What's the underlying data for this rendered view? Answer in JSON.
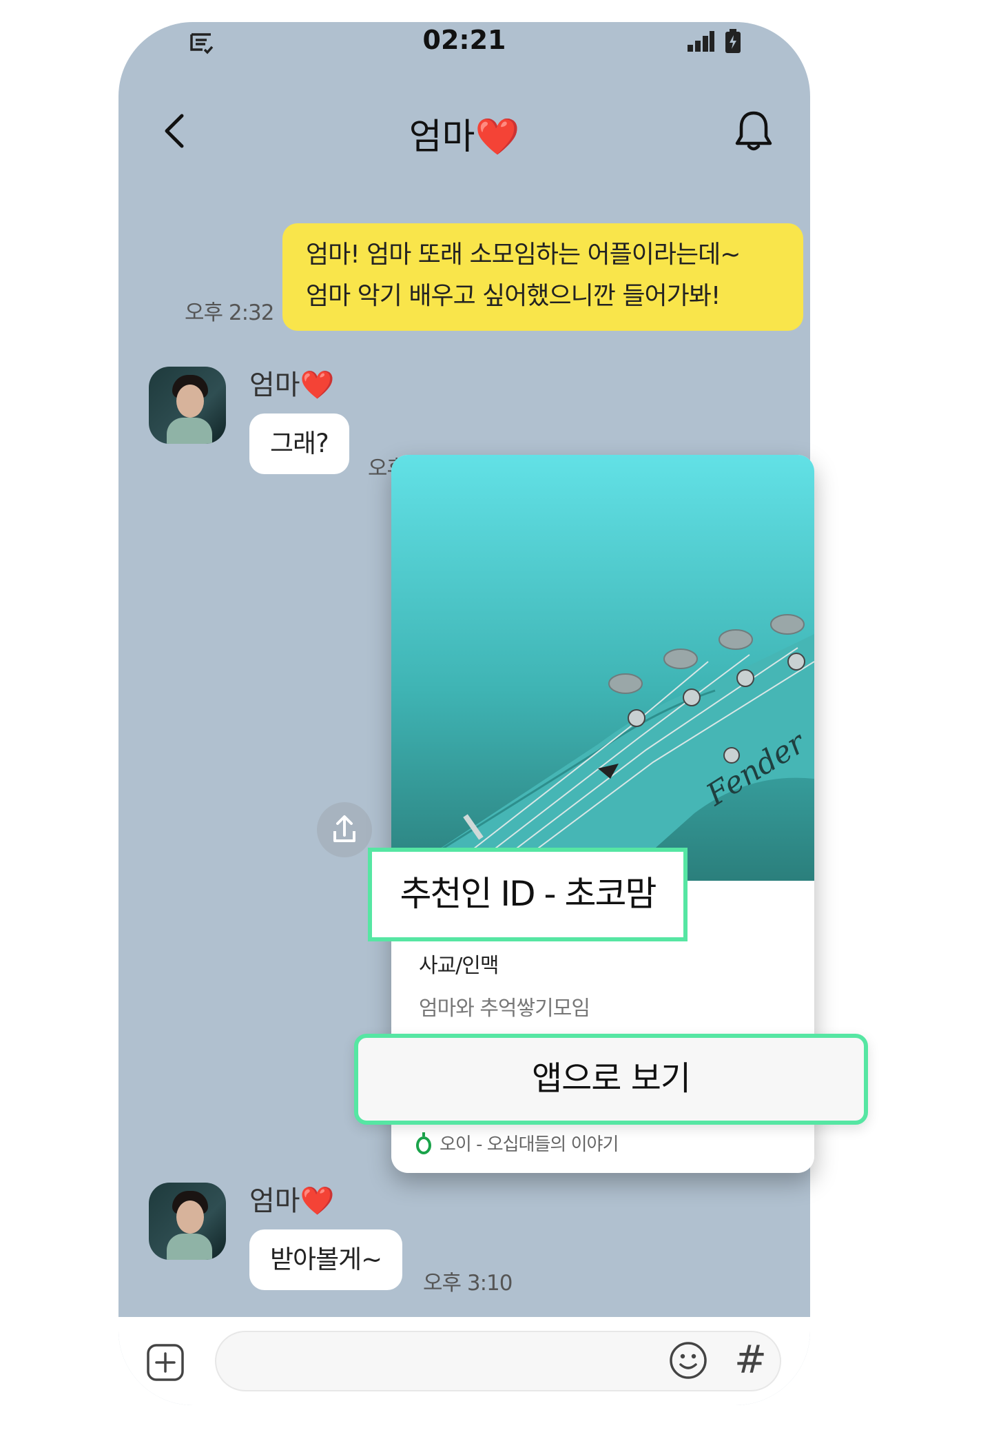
{
  "status_bar": {
    "time": "02:21"
  },
  "header": {
    "title": "엄마❤️"
  },
  "messages": {
    "me": {
      "line1": "엄마! 엄마 또래 소모임하는 어플이라는데~",
      "line2": "엄마 악기 배우고 싶어했으니깐 들어가봐!",
      "time": "오후 2:32"
    },
    "mom1": {
      "sender": "엄마❤️",
      "text": "그래?",
      "time_partial": "오후"
    },
    "mom2": {
      "sender": "엄마❤️",
      "text": "받아볼게~",
      "time": "오후 3:10"
    }
  },
  "card": {
    "referrer": "추천인 ID - 초코맘",
    "category": "사교/인맥",
    "group": "엄마와 추억쌓기모임",
    "open_button": "앱으로 보기",
    "app_name": "오이 - 오십대들의 이야기"
  },
  "input_bar": {
    "placeholder": ""
  },
  "colors": {
    "chat_bg": "#b0c0cf",
    "my_bubble": "#f9e54b",
    "highlight": "#56e6a3",
    "card_image": "#4fc9cc"
  }
}
